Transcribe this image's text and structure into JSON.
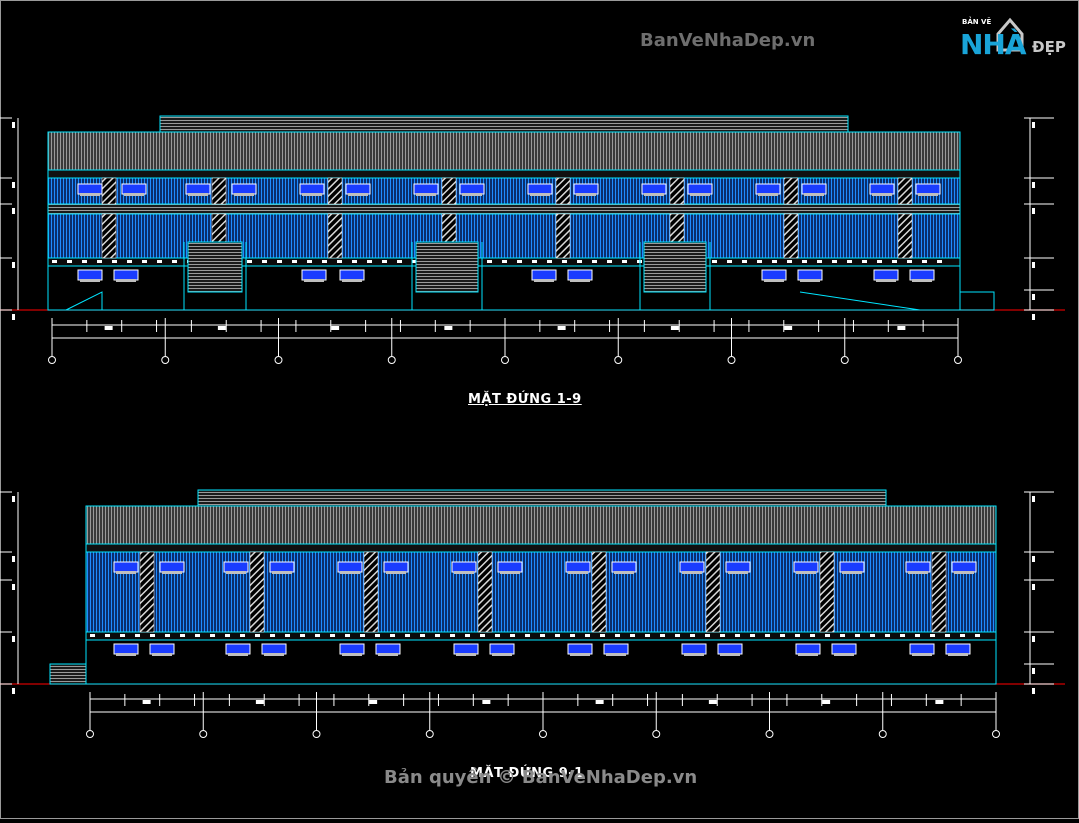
{
  "watermark_top": "BanVeNhaDep.vn",
  "watermark_bottom": "Bản quyền © BanVeNhaDep.vn",
  "logo": {
    "small_text": "BẢN VẼ",
    "big_text": "NHÀ",
    "suffix_text": "ĐẸP"
  },
  "elevation_1": {
    "title": "MẶT ĐỨNG 1-9",
    "grid_axes": 9,
    "bays": 8,
    "doors": 3
  },
  "elevation_2": {
    "title": "MẶT ĐỨNG 9-1",
    "grid_axes": 9,
    "bays": 8
  },
  "colors": {
    "background": "#000000",
    "outline": "#00e5ff",
    "cladding": "#1b6fd0",
    "roof": "#8a8a8a",
    "ground_line": "#d00000",
    "dimension": "#ffffff",
    "window": "#1a3cff"
  }
}
